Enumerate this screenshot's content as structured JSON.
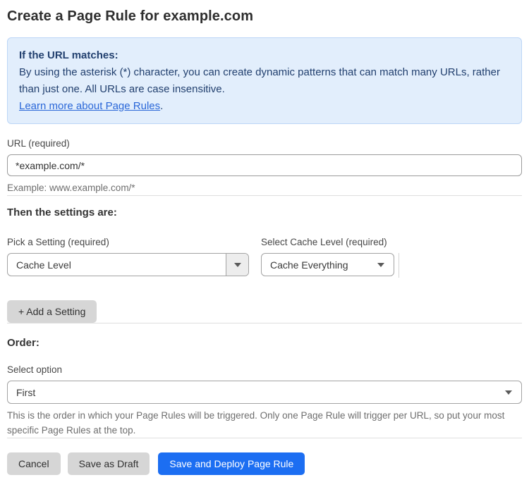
{
  "page": {
    "title": "Create a Page Rule for example.com"
  },
  "info_box": {
    "heading": "If the URL matches:",
    "body": "By using the asterisk (*) character, you can create dynamic patterns that can match many URLs, rather than just one. All URLs are case insensitive.",
    "link_label": "Learn more about Page Rules",
    "link_suffix": "."
  },
  "url_field": {
    "label": "URL (required)",
    "value": "*example.com/*",
    "helper": "Example: www.example.com/*"
  },
  "settings_section": {
    "heading": "Then the settings are:",
    "setting_picker": {
      "label": "Pick a Setting (required)",
      "value": "Cache Level"
    },
    "cache_level_picker": {
      "label": "Select Cache Level (required)",
      "value": "Cache Everything"
    },
    "add_setting_label": "+ Add a Setting"
  },
  "order_section": {
    "heading": "Order:",
    "label": "Select option",
    "value": "First",
    "helper": "This is the order in which your Page Rules will be triggered. Only one Page Rule will trigger per URL, so put your most specific Page Rules at the top."
  },
  "footer": {
    "cancel_label": "Cancel",
    "save_draft_label": "Save as Draft",
    "save_deploy_label": "Save and Deploy Page Rule"
  },
  "colors": {
    "accent_blue": "#1c6ef2",
    "info_background": "#e2eefc",
    "info_border": "#bcd6f7",
    "info_text": "#22406f",
    "link_blue": "#2a67d8",
    "button_gray": "#d6d6d6"
  }
}
